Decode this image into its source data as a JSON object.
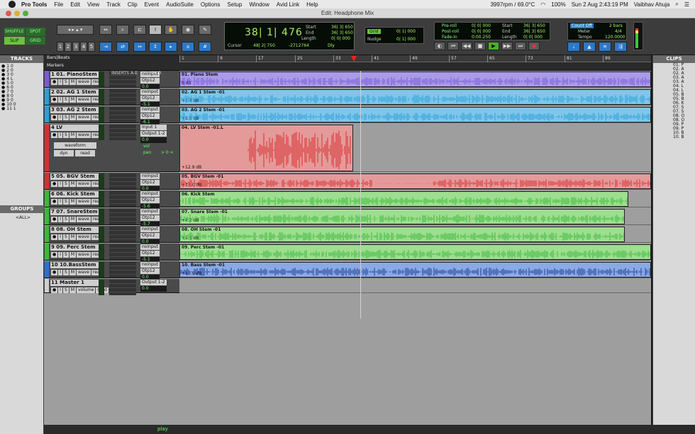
{
  "menubar": {
    "items": [
      "Pro Tools",
      "File",
      "Edit",
      "View",
      "Track",
      "Clip",
      "Event",
      "AudioSuite",
      "Options",
      "Setup",
      "Window",
      "Avid Link",
      "Help"
    ],
    "status": [
      "3997rpm / 69.0°C",
      "100%",
      "Sun 2 Aug  2:43:19 PM",
      "Vaibhav Ahuja"
    ]
  },
  "window": {
    "title": "Edit: Headphone Mix"
  },
  "toolbar": {
    "modes": [
      "SHUFFLE",
      "SPOT",
      "SLIP",
      "GRID"
    ],
    "zoom_presets": [
      "1",
      "2",
      "3",
      "4",
      "5"
    ],
    "counter": {
      "main": "38| 1| 476",
      "cursor_label": "Cursor",
      "cursor_value": "48| 2| 750",
      "sample": "-2712764",
      "dly": "Dly"
    },
    "sel": {
      "start_label": "Start",
      "end_label": "End",
      "length_label": "Length",
      "start": "36| 3| 650",
      "end": "36| 3| 650",
      "length": "0| 0| 000"
    },
    "grid": {
      "label": "Grid",
      "value": "0| 1| 000",
      "nudge_label": "Nudge",
      "nudge_value": "0| 1| 000"
    },
    "roll": {
      "preroll": "Pre-roll",
      "postroll": "Post-roll",
      "fadein": "Fade-in",
      "pre_val": "0| 0| 000",
      "post_val": "0| 0| 000",
      "fade_val": "0:00.250",
      "start": "36| 3| 650",
      "end": "36| 3| 650",
      "length": "0| 0| 000"
    },
    "meter": {
      "countoff": "Count Off",
      "bars": "2 bars",
      "meter_label": "Meter",
      "meter_value": "4/4",
      "tempo_label": "Tempo",
      "tempo_value": "120.0000"
    }
  },
  "ruler": {
    "label1": "Bars|Beats",
    "label2": "Markers",
    "bars": [
      "1",
      "9",
      "17",
      "25",
      "33",
      "41",
      "49",
      "57",
      "65",
      "73",
      "81",
      "89"
    ]
  },
  "panels": {
    "tracks_title": "TRACKS",
    "groups_title": "GROUPS",
    "groups_item": "<ALL>",
    "clips_title": "CLIPS"
  },
  "track_list": [
    "1 0",
    "2 0",
    "3 0",
    "4 L",
    "5 0",
    "6 0",
    "7 0",
    "8 0",
    "9 0",
    "10 0",
    "11 1"
  ],
  "clips_list": [
    "01. P",
    "02. A",
    "02. A",
    "03. A",
    "03. A",
    "04. L",
    "04. L",
    "05. B",
    "05. B",
    "06. K",
    "07. S",
    "07. S",
    "08. O",
    "08. O",
    "09. P",
    "09. P",
    "10. B",
    "10. B"
  ],
  "inserts_header": "INSERTS A-E",
  "io_header": "I / O",
  "tracks": [
    {
      "name": "1 01. PianoStem",
      "color": "#7a5ad6",
      "io": "noinput",
      "out": "Otp12",
      "vol": "0.0",
      "clip": "01. Piano Stem",
      "gain": "0 dB",
      "lane": "#a99be8"
    },
    {
      "name": "2 02. AG 1 Stem",
      "color": "#2d9ed6",
      "io": "noinput",
      "out": "Otp12",
      "vol": "-5.1",
      "clip": "02. AG 1 Stem -01",
      "gain": "+5.7 dB",
      "lane": "#7ec7ea"
    },
    {
      "name": "3 03. AG 2 Stem",
      "color": "#2d9ed6",
      "io": "noinput",
      "out": "Otp12",
      "vol": "-6.1",
      "clip": "03. AG 2 Stem -01",
      "gain": "+5.6 dB",
      "lane": "#7ec7ea"
    },
    {
      "name": "4   LV",
      "color": "#d63030",
      "io": "Input 1",
      "out": "Output 1-2",
      "vol": "0.0",
      "clip": "04. LV Stem -01.L",
      "gain": "+12.9 dB",
      "lane": "#e59a9a"
    },
    {
      "name": "5 05. BGV Stem",
      "color": "#d63030",
      "io": "noinput",
      "out": "Otp12",
      "vol": "0.0",
      "clip": "05. BGV Stem -01",
      "gain": "+13.0 dB",
      "lane": "#e59a9a"
    },
    {
      "name": "6 06. Kick Stem",
      "color": "#3cb83c",
      "io": "noinput",
      "out": "Otp12",
      "vol": "-5.6",
      "clip": "06. Kick Stem",
      "gain": "",
      "lane": "#9ede8f"
    },
    {
      "name": "7 07. SnareStem",
      "color": "#3cb83c",
      "io": "noinput",
      "out": "Otp12",
      "vol": "-5.7",
      "clip": "07. Snare Stem -01",
      "gain": "+4.2 dB",
      "lane": "#9ede8f"
    },
    {
      "name": "8 08. OH Stem",
      "color": "#3cb83c",
      "io": "noinput",
      "out": "Otp12",
      "vol": "0.0",
      "clip": "08. OH Stem -01",
      "gain": "+9.3 dB",
      "lane": "#9ede8f"
    },
    {
      "name": "9 09. Perc Stem",
      "color": "#3cb83c",
      "io": "noinput",
      "out": "Otp12",
      "vol": "-5.1",
      "clip": "09. Perc Stem -01",
      "gain": "",
      "lane": "#9ede8f"
    },
    {
      "name": "10 10.BassStem",
      "color": "#2c6fd6",
      "io": "noinput",
      "out": "Otp12",
      "vol": "0.0",
      "clip": "10. Bass Stem -01",
      "gain": "+10.9 dB",
      "lane": "#8aaae5"
    },
    {
      "name": "11   Master 1",
      "color": "#cfcfcf",
      "io": "Output 1-2",
      "out": "",
      "vol": "0.0",
      "clip": "",
      "gain": "",
      "lane": "#9e9e9e"
    }
  ],
  "lv_track": {
    "waveform": "waveform",
    "dyn": "dyn",
    "read": "read",
    "vol_label": "vol",
    "pan_label": "pan",
    "pan": "> 0 <"
  },
  "labels": {
    "wave": "wave",
    "read": "read",
    "volume": "volume"
  },
  "status": {
    "play": "play"
  }
}
